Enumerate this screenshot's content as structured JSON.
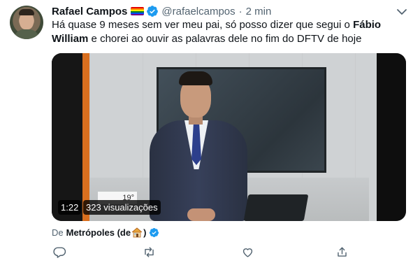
{
  "tweet": {
    "author": {
      "name": "Rafael Campos",
      "handle": "@rafaelcampos",
      "flag_icon": "rainbow-flag",
      "verified_icon": "verified-badge-icon"
    },
    "separator": "·",
    "time": "2 min",
    "text": {
      "before": "Há quase 9 meses sem ver meu pai, só posso dizer que segui o ",
      "bold": "Fábio William",
      "after": " e chorei ao ouvir as palavras dele no fim do DFTV de hoje"
    },
    "video": {
      "duration": "1:22",
      "views": "323 visualizações",
      "weather_overlay": "19°"
    },
    "source": {
      "prefix": "De",
      "name": "Metrópoles (de",
      "suffix": ")",
      "house_icon": "house-emoji-icon"
    },
    "actions": [
      "reply-icon",
      "retweet-icon",
      "like-icon",
      "share-icon"
    ],
    "colors": {
      "text": "#0f1419",
      "secondary": "#536471",
      "verified": "#1d9bf0"
    }
  }
}
